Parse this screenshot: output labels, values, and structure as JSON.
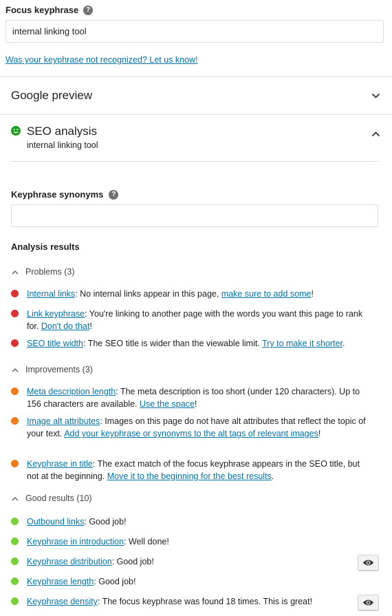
{
  "focus_keyphrase": {
    "label": "Focus keyphrase",
    "value": "internal linking tool",
    "help_icon": "?",
    "link": "Was your keyphrase not recognized? Let us know!"
  },
  "google_preview": {
    "title": "Google preview"
  },
  "seo_analysis": {
    "title": "SEO analysis",
    "subtitle": "internal linking tool",
    "status_color": "#1f9d1f"
  },
  "keyphrase_synonyms": {
    "label": "Keyphrase synonyms",
    "value": ""
  },
  "analysis_results": {
    "label": "Analysis results",
    "colors": {
      "problem": "#dc3232",
      "improvement": "#ee7c1b",
      "good": "#7ad03a"
    },
    "problems": {
      "heading": "Problems (3)",
      "items": [
        {
          "link": "Internal links",
          "text": ": No internal links appear in this page, ",
          "action": "make sure to add some",
          "tail": "!"
        },
        {
          "link": "Link keyphrase",
          "text": ": You're linking to another page with the words you want this page to rank for. ",
          "action": "Don't do that",
          "tail": "!"
        },
        {
          "link": "SEO title width",
          "text": ": The SEO title is wider than the viewable limit. ",
          "action": "Try to make it shorter",
          "tail": "."
        }
      ]
    },
    "improvements": {
      "heading": "Improvements (3)",
      "items": [
        {
          "link": "Meta description length",
          "text": ": The meta description is too short (under 120 characters). Up to 156 characters are available. ",
          "action": "Use the space",
          "tail": "!"
        },
        {
          "link": "Image alt attributes",
          "text": ": Images on this page do not have alt attributes that reflect the topic of your text. ",
          "action": "Add your keyphrase or synonyms to the alt tags of relevant images",
          "tail": "!"
        },
        {
          "link": "Keyphrase in title",
          "text": ": The exact match of the focus keyphrase appears in the SEO title, but not at the beginning. ",
          "action": "Move it to the beginning for the best results",
          "tail": "."
        }
      ]
    },
    "good_results": {
      "heading": "Good results (10)",
      "items": [
        {
          "link": "Outbound links",
          "text": ": Good job!"
        },
        {
          "link": "Keyphrase in introduction",
          "text": ": Well done!"
        },
        {
          "link": "Keyphrase distribution",
          "text": ": Good job!",
          "eye": true
        },
        {
          "link": "Keyphrase length",
          "text": ": Good job!"
        },
        {
          "link": "Keyphrase density",
          "text": ": The focus keyphrase was found 18 times. This is great!",
          "eye": true
        }
      ]
    }
  }
}
